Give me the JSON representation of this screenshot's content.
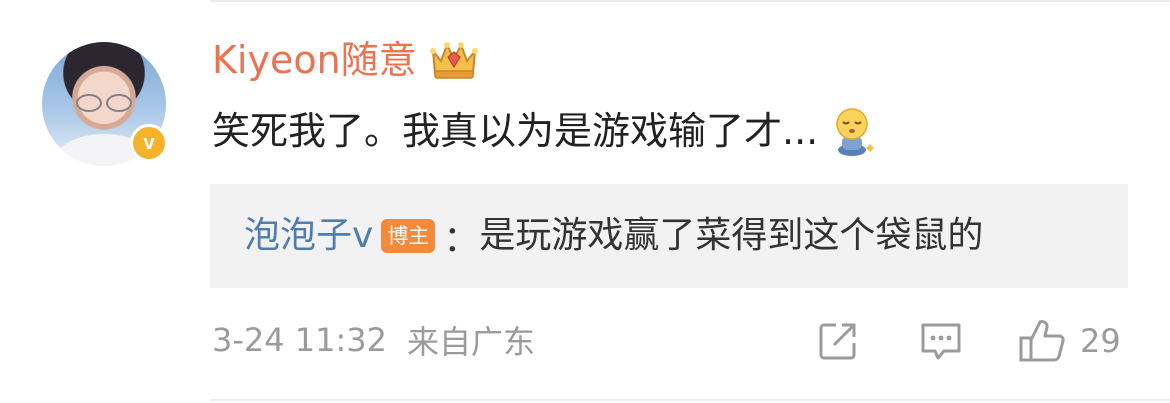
{
  "comment": {
    "username": "Kiyeon随意",
    "text": "笑死我了。我真以为是游戏输了才...",
    "verified_mark": "v",
    "time": "3-24 11:32",
    "location": "来自广东",
    "like_count": "29"
  },
  "reply": {
    "user": "泡泡子v",
    "tag": "博主",
    "colon": "：",
    "text": "是玩游戏赢了菜得到这个袋鼠的"
  },
  "icons": {
    "badge": "crown-badge-icon",
    "emoji": "sleepy-face-emoji-icon",
    "share": "share-icon",
    "comment": "comment-icon",
    "like": "thumbs-up-icon"
  },
  "colors": {
    "username": "#eb7350",
    "reply_user": "#507daf",
    "blogger_tag": "#f28a3a",
    "verified": "#f6b22a",
    "meta": "#9b9b9b"
  }
}
